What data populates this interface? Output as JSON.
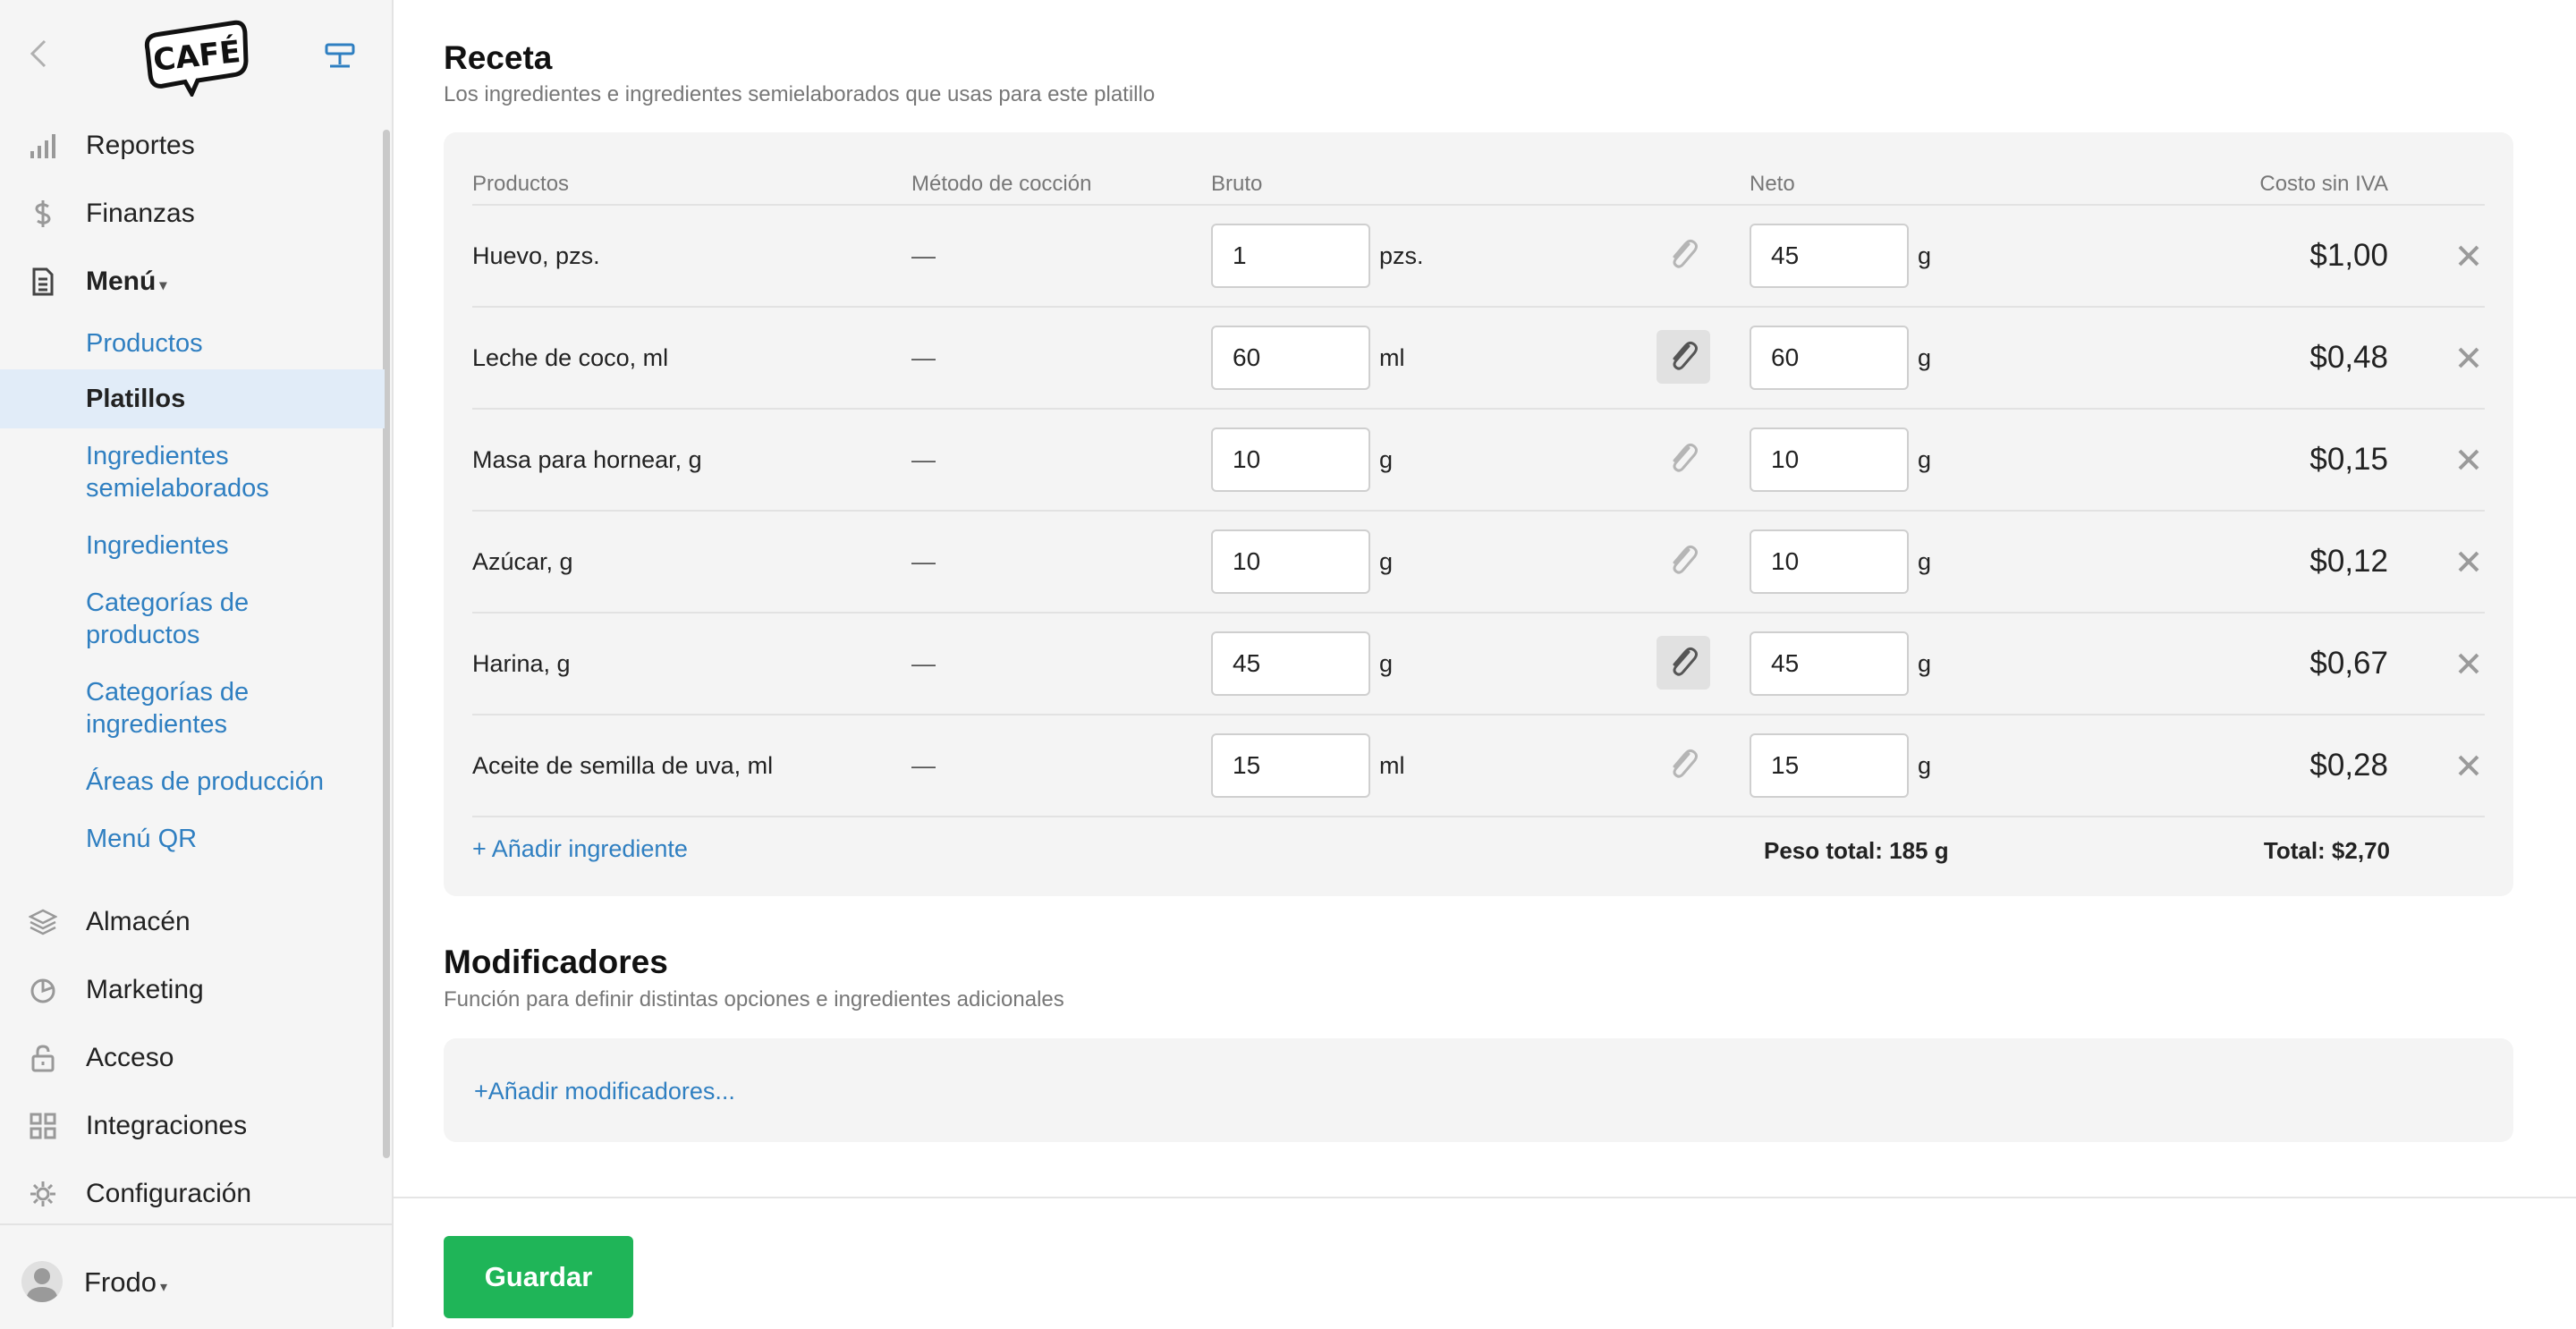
{
  "sidebar": {
    "logo_text": "CAFÉ",
    "items": [
      {
        "label": "Reportes",
        "icon": "bar-chart-icon"
      },
      {
        "label": "Finanzas",
        "icon": "dollar-icon"
      },
      {
        "label": "Menú",
        "icon": "document-icon",
        "expanded": true
      },
      {
        "label": "Almacén",
        "icon": "layers-icon"
      },
      {
        "label": "Marketing",
        "icon": "pie-icon"
      },
      {
        "label": "Acceso",
        "icon": "lock-icon"
      },
      {
        "label": "Integraciones",
        "icon": "grid-icon"
      },
      {
        "label": "Configuración",
        "icon": "gear-icon"
      }
    ],
    "menu_sub": [
      {
        "label": "Productos"
      },
      {
        "label": "Platillos",
        "active": true
      },
      {
        "label": "Ingredientes semielaborados"
      },
      {
        "label": "Ingredientes"
      },
      {
        "label": "Categorías de productos"
      },
      {
        "label": "Categorías de ingredientes"
      },
      {
        "label": "Áreas de producción"
      },
      {
        "label": "Menú QR"
      }
    ],
    "user": {
      "name": "Frodo"
    }
  },
  "recipe": {
    "title": "Receta",
    "subtitle": "Los ingredientes e ingredientes semielaborados que usas para este platillo",
    "columns": {
      "products": "Productos",
      "method": "Método de cocción",
      "gross": "Bruto",
      "net": "Neto",
      "cost": "Costo sin IVA"
    },
    "rows": [
      {
        "product": "Huevo, pzs.",
        "method": "—",
        "gross": "1",
        "gross_unit": "pzs.",
        "net": "45",
        "net_unit": "g",
        "cost": "$1,00",
        "clip_active": false
      },
      {
        "product": "Leche de coco, ml",
        "method": "—",
        "gross": "60",
        "gross_unit": "ml",
        "net": "60",
        "net_unit": "g",
        "cost": "$0,48",
        "clip_active": true
      },
      {
        "product": "Masa para hornear, g",
        "method": "—",
        "gross": "10",
        "gross_unit": "g",
        "net": "10",
        "net_unit": "g",
        "cost": "$0,15",
        "clip_active": false
      },
      {
        "product": "Azúcar, g",
        "method": "—",
        "gross": "10",
        "gross_unit": "g",
        "net": "10",
        "net_unit": "g",
        "cost": "$0,12",
        "clip_active": false
      },
      {
        "product": "Harina, g",
        "method": "—",
        "gross": "45",
        "gross_unit": "g",
        "net": "45",
        "net_unit": "g",
        "cost": "$0,67",
        "clip_active": true
      },
      {
        "product": "Aceite de semilla de uva, ml",
        "method": "—",
        "gross": "15",
        "gross_unit": "ml",
        "net": "15",
        "net_unit": "g",
        "cost": "$0,28",
        "clip_active": false
      }
    ],
    "add_ingredient": "+ Añadir ingrediente",
    "total_weight": "Peso total: 185 g",
    "total": "Total: $2,70"
  },
  "modifiers": {
    "title": "Modificadores",
    "subtitle": "Función para definir distintas opciones e ingredientes adicionales",
    "add_label": "+Añadir modificadores..."
  },
  "footer": {
    "save_label": "Guardar"
  },
  "colors": {
    "accent": "#2f7fc1",
    "save": "#1fb558",
    "active_bg": "#e1ecf8"
  }
}
